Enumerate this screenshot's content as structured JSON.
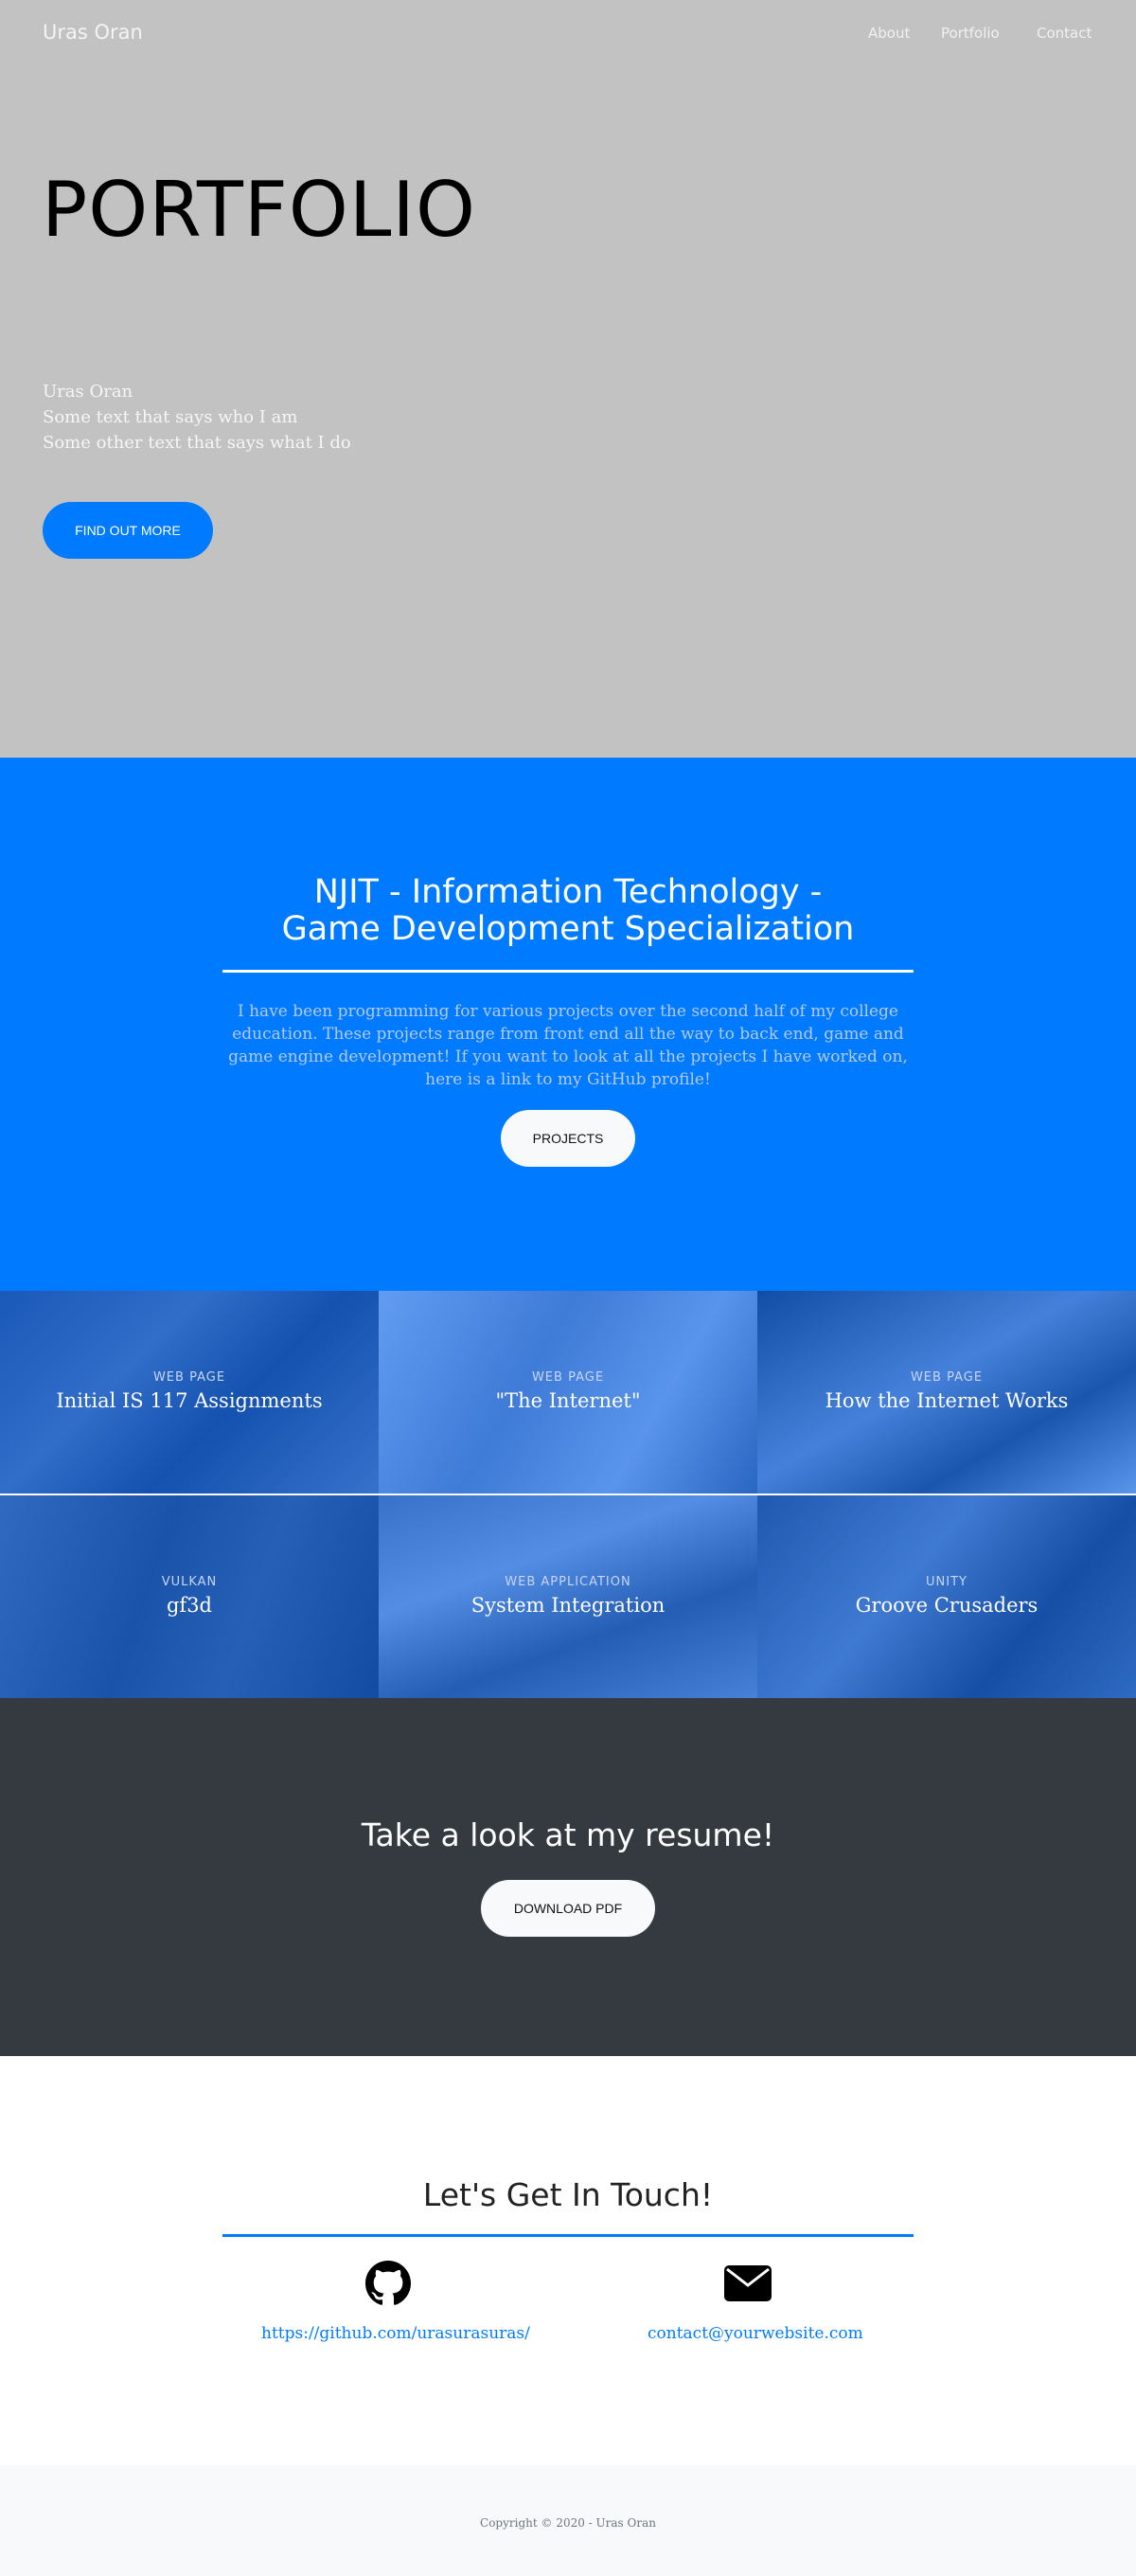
{
  "nav": {
    "brand": "Uras Oran",
    "links": [
      "About",
      "Portfolio",
      "Contact"
    ]
  },
  "hero": {
    "title": "PORTFOLIO",
    "lines": [
      "Uras Oran",
      "Some text that says who I am",
      "Some other text that says what I do"
    ],
    "button": "FIND OUT MORE"
  },
  "about": {
    "title_line1": "NJIT - Information Technology -",
    "title_line2": "Game Development Specialization",
    "text": "I have been programming for various projects over the second half of my college education. These projects range from front end all the way to back end, game and game engine development! If you want to look at all the projects I have worked on, here is a link to my GitHub profile!",
    "button": "PROJECTS"
  },
  "portfolio": {
    "items": [
      {
        "category": "WEB PAGE",
        "name": "Initial IS 117 Assignments"
      },
      {
        "category": "WEB PAGE",
        "name": "\"The Internet\""
      },
      {
        "category": "WEB PAGE",
        "name": "How the Internet Works"
      },
      {
        "category": "VULKAN",
        "name": "gf3d"
      },
      {
        "category": "WEB APPLICATION",
        "name": "System Integration"
      },
      {
        "category": "UNITY",
        "name": "Groove Crusaders"
      }
    ]
  },
  "resume": {
    "title": "Take a look at my resume!",
    "button": "DOWNLOAD PDF"
  },
  "contact": {
    "title": "Let's Get In Touch!",
    "github_icon": "github-icon",
    "github_link": "https://github.com/urasurasuras/",
    "email_icon": "envelope-icon",
    "email_link": "contact@yourwebsite.com"
  },
  "footer": {
    "copyright": "Copyright © 2020 - Uras Oran"
  },
  "colors": {
    "primary": "#007bff",
    "hero_bg": "#c2c2c2",
    "dark": "#343a40",
    "light": "#f8f9fa"
  }
}
